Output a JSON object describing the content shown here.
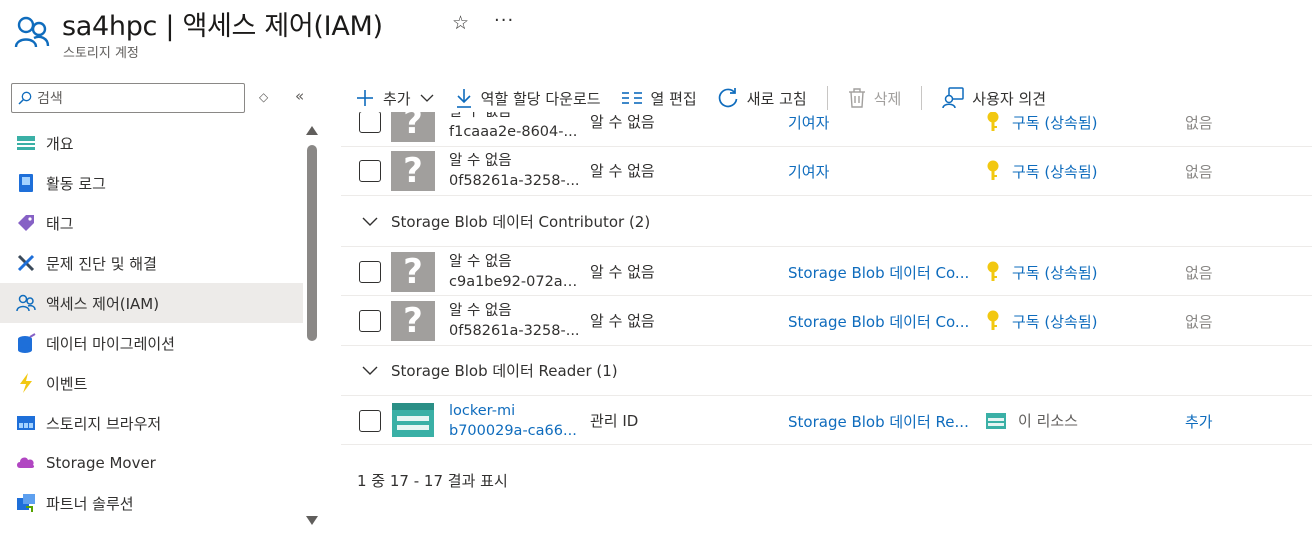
{
  "header": {
    "title": "sa4hpc | 액세스 제어(IAM)",
    "subtitle": "스토리지 계정",
    "favorite_icon": "star-icon",
    "more_label": "···"
  },
  "sidebar": {
    "search_placeholder": "검색",
    "items": [
      {
        "label": "개요",
        "icon": "overview-icon"
      },
      {
        "label": "활동 로그",
        "icon": "activity-log-icon"
      },
      {
        "label": "태그",
        "icon": "tag-icon"
      },
      {
        "label": "문제 진단 및 해결",
        "icon": "wrench-icon"
      },
      {
        "label": "액세스 제어(IAM)",
        "icon": "iam-icon",
        "active": true
      },
      {
        "label": "데이터 마이그레이션",
        "icon": "data-migration-icon"
      },
      {
        "label": "이벤트",
        "icon": "lightning-icon"
      },
      {
        "label": "스토리지 브라우저",
        "icon": "storage-browser-icon"
      },
      {
        "label": "Storage Mover",
        "icon": "cloud-icon"
      },
      {
        "label": "파트너 솔루션",
        "icon": "partner-icon"
      }
    ]
  },
  "toolbar": {
    "add": "추가",
    "download": "역할 할당 다운로드",
    "edit_columns": "열 편집",
    "refresh": "새로 고침",
    "delete": "삭제",
    "feedback": "사용자 의견"
  },
  "table": {
    "rows": [
      {
        "kind": "assignment",
        "name": "알 수 없음",
        "id": "f1caaa2e-8604-...",
        "type": "알 수 없음",
        "role": "기여자",
        "scope": "구독 (상속됨)",
        "scope_icon": "key-icon",
        "condition": "없음"
      },
      {
        "kind": "assignment",
        "name": "알 수 없음",
        "id": "0f58261a-3258-...",
        "type": "알 수 없음",
        "role": "기여자",
        "scope": "구독 (상속됨)",
        "scope_icon": "key-icon",
        "condition": "없음"
      },
      {
        "kind": "group",
        "label": "Storage Blob 데이터 Contributor (2)"
      },
      {
        "kind": "assignment",
        "name": "알 수 없음",
        "id": "c9a1be92-072a-...",
        "type": "알 수 없음",
        "role": "Storage Blob 데이터 Co...",
        "scope": "구독 (상속됨)",
        "scope_icon": "key-icon",
        "condition": "없음"
      },
      {
        "kind": "assignment",
        "name": "알 수 없음",
        "id": "0f58261a-3258-...",
        "type": "알 수 없음",
        "role": "Storage Blob 데이터 Co...",
        "scope": "구독 (상속됨)",
        "scope_icon": "key-icon",
        "condition": "없음"
      },
      {
        "kind": "group",
        "label": "Storage Blob 데이터 Reader (1)"
      },
      {
        "kind": "assignment",
        "name": "locker-mi",
        "id": "b700029a-ca66...",
        "type": "관리 ID",
        "role": "Storage Blob 데이터 Re...",
        "scope": "이 리소스",
        "scope_icon": "storage-account-icon",
        "condition": "추가",
        "avatar": "managed-identity"
      }
    ]
  },
  "footer": {
    "pagination": "1 중 17 - 17 결과 표시"
  }
}
